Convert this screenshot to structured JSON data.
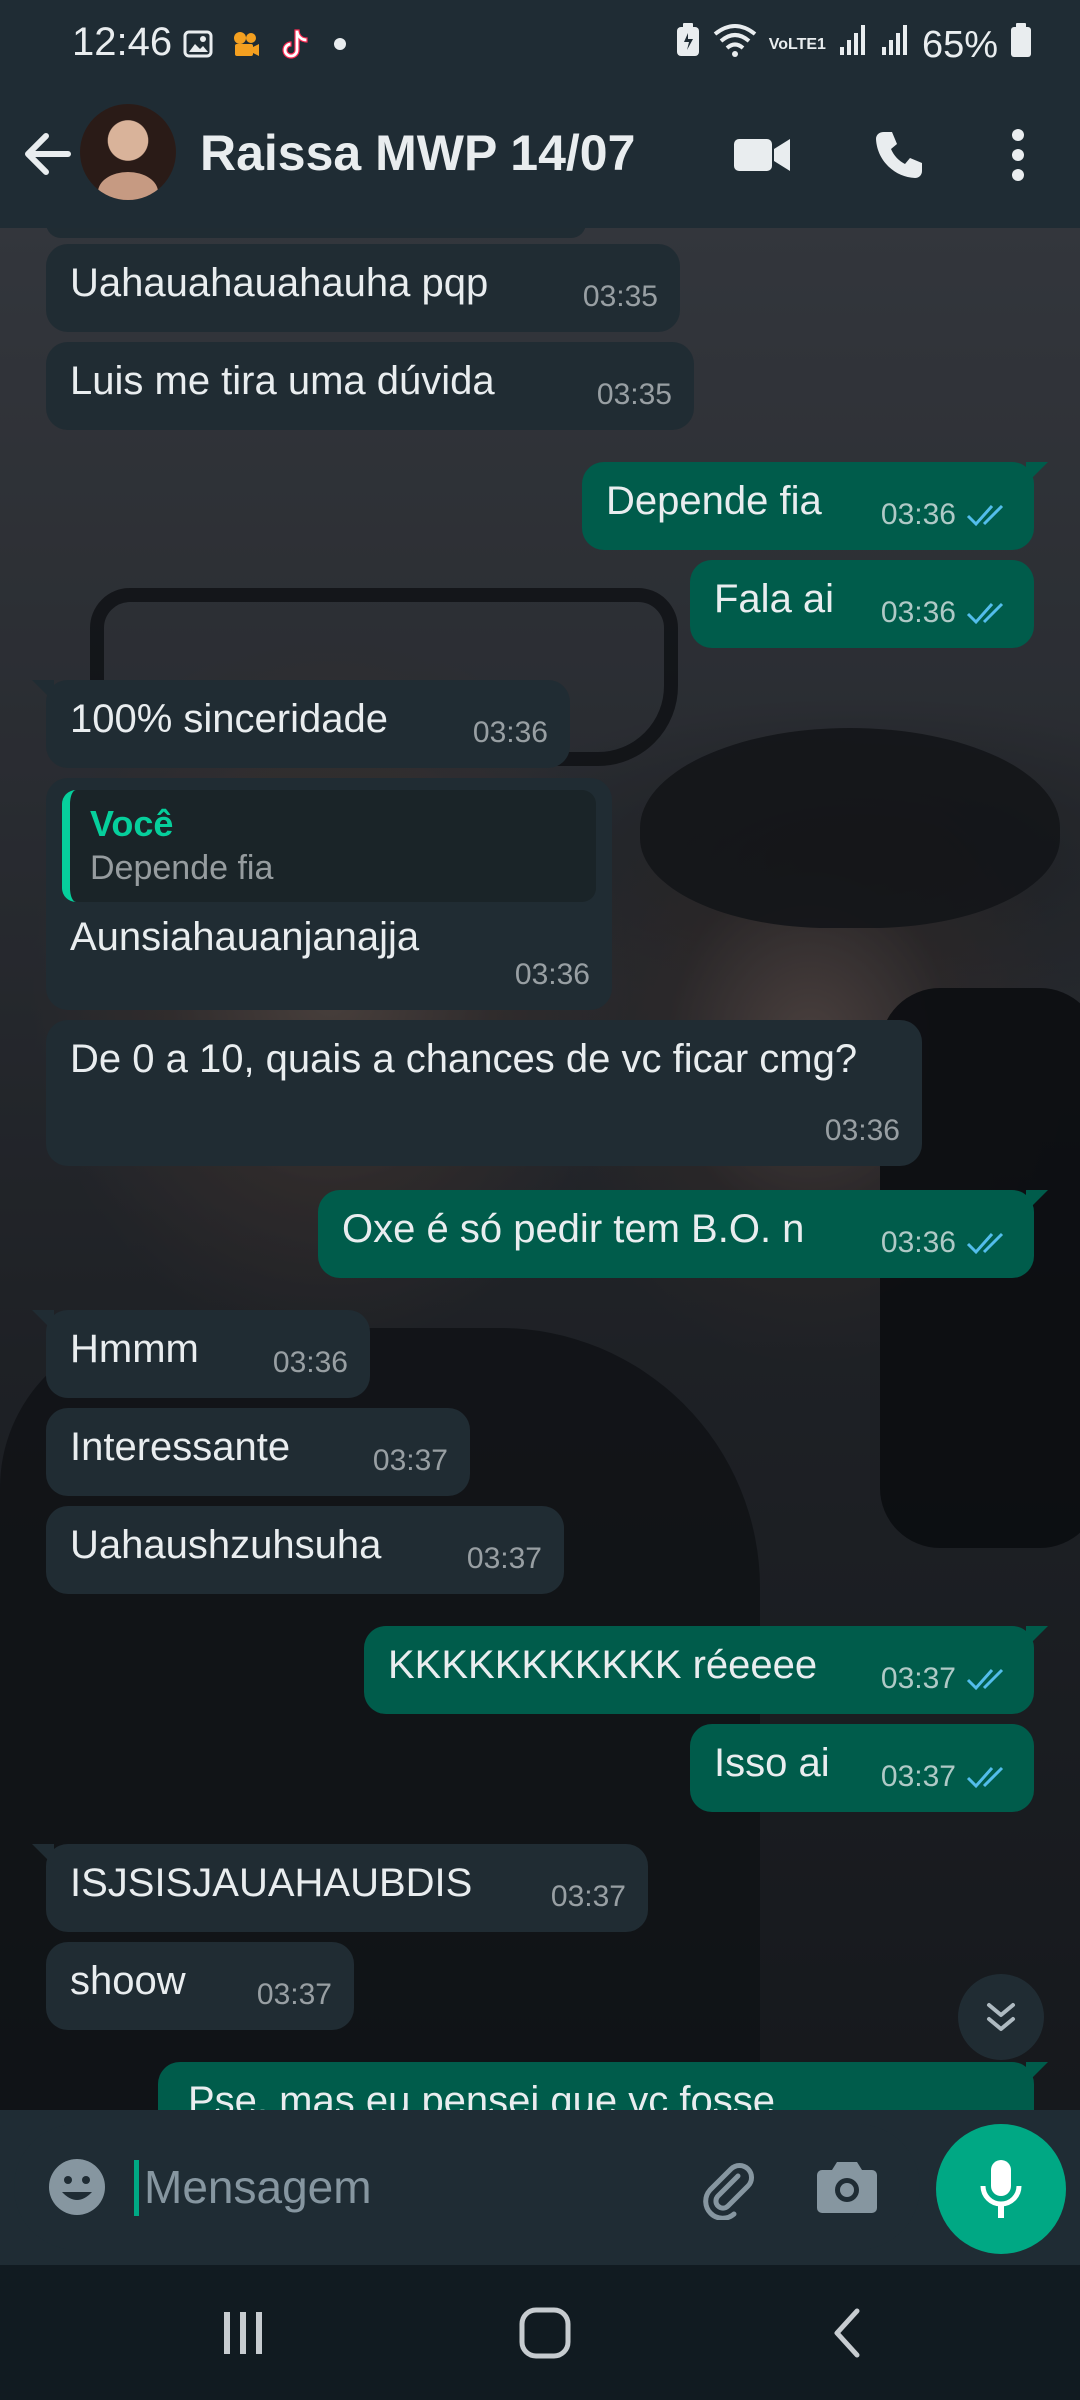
{
  "status_bar": {
    "time": "12:46",
    "battery": "65%",
    "network": "VoLTE1",
    "icons": [
      "gallery-icon",
      "video-app-icon",
      "tiktok-icon",
      "notification-dot",
      "battery-saver-icon",
      "wifi-icon",
      "signal-icon",
      "signal-icon",
      "battery-icon"
    ]
  },
  "header": {
    "contact_name": "Raissa MWP 14/07",
    "icons": [
      "back-arrow-icon",
      "video-call-icon",
      "phone-icon",
      "more-vertical-icon"
    ]
  },
  "messages": [
    {
      "dir": "in",
      "text": "Uahauahauahauha pqp",
      "time": "03:35"
    },
    {
      "dir": "in",
      "text": "Luis me tira uma dúvida",
      "time": "03:35"
    },
    {
      "dir": "out",
      "text": "Depende fia",
      "time": "03:36",
      "status": "read"
    },
    {
      "dir": "out",
      "text": "Fala ai",
      "time": "03:36",
      "status": "read"
    },
    {
      "dir": "in",
      "text": "100% sinceridade",
      "time": "03:36"
    },
    {
      "dir": "in",
      "text": "Aunsiahauanjanajja",
      "time": "03:36",
      "quote": {
        "author": "Você",
        "text": "Depende fia"
      }
    },
    {
      "dir": "in",
      "text": "De 0 a 10, quais a chances de vc ficar cmg?",
      "time": "03:36"
    },
    {
      "dir": "out",
      "text": "Oxe é só pedir tem B.O. n",
      "time": "03:36",
      "status": "read"
    },
    {
      "dir": "in",
      "text": "Hmmm",
      "time": "03:36"
    },
    {
      "dir": "in",
      "text": "Interessante",
      "time": "03:37"
    },
    {
      "dir": "in",
      "text": "Uahaushzuhsuha",
      "time": "03:37"
    },
    {
      "dir": "out",
      "text": "KKKKKKKKKKK réeeee",
      "time": "03:37",
      "status": "read"
    },
    {
      "dir": "out",
      "text": "Isso ai",
      "time": "03:37",
      "status": "read"
    },
    {
      "dir": "in",
      "text": "ISJSISJAUAHAUBDIS",
      "time": "03:37"
    },
    {
      "dir": "in",
      "text": "shoow",
      "time": "03:37"
    },
    {
      "dir": "out",
      "text": "Pse, mas eu pensei que vc fosse",
      "time": "",
      "status": "partial"
    }
  ],
  "composer": {
    "placeholder": "Mensagem",
    "icons": [
      "emoji-icon",
      "attach-icon",
      "camera-icon",
      "mic-icon"
    ]
  },
  "navbar": {
    "icons": [
      "recent-apps-icon",
      "home-icon",
      "back-nav-icon"
    ]
  },
  "colors": {
    "incoming_bubble": "#202c33",
    "outgoing_bubble": "#005c4b",
    "accent": "#00a884",
    "read_ticks": "#53bdeb",
    "header_bg": "#1f2c34"
  }
}
